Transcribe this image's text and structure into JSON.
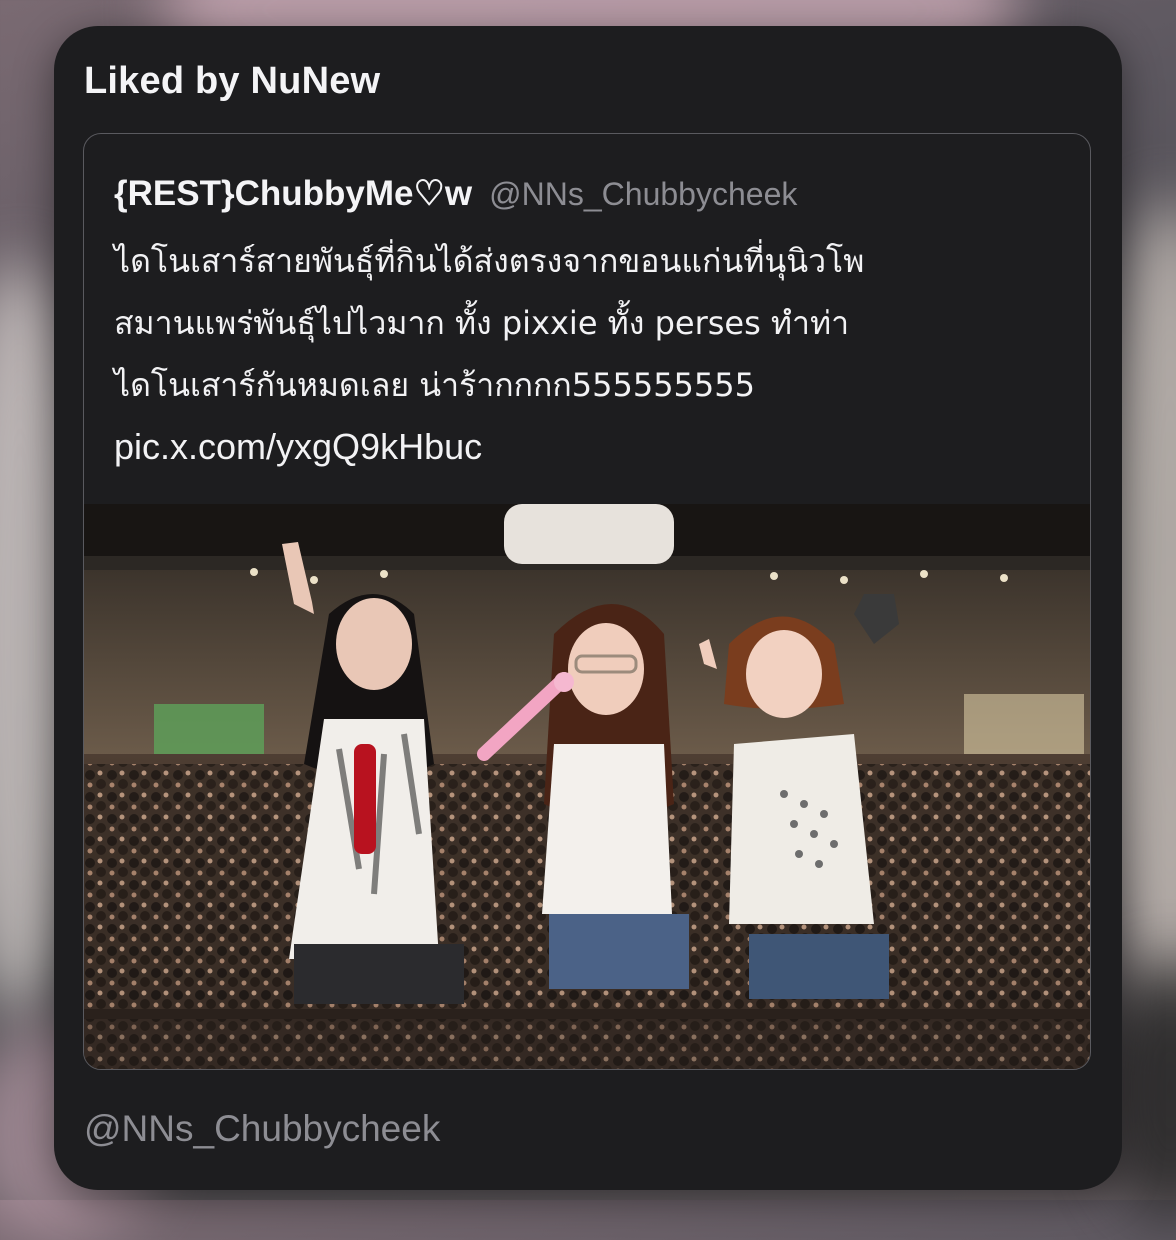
{
  "header": {
    "title": "Liked by NuNew"
  },
  "tweet": {
    "display_name": "{REST}ChubbyMe♡w",
    "handle": "@NNs_Chubbycheek",
    "lines": [
      "ไดโนเสาร์สายพันธุ์ที่กินได้ส่งตรงจากขอนแก่นที่นุนิวโพ",
      "สมานแพร่พันธุ์ไปไวมาก ทั้ง pixxie ทั้ง perses ทำท่า",
      "ไดโนเสาร์กันหมดเลย น่าร้ากกกก555555555"
    ],
    "link": "pic.x.com/yxgQ9kHbuc",
    "image_alt": "Three performers on stage in front of a large crowd"
  },
  "footer": {
    "handle": "@NNs_Chubbycheek"
  },
  "colors": {
    "card_bg": "#1d1d1f",
    "text_primary": "#f4f4f6",
    "text_secondary": "#8d8d93",
    "border": "#5a5a5f"
  }
}
